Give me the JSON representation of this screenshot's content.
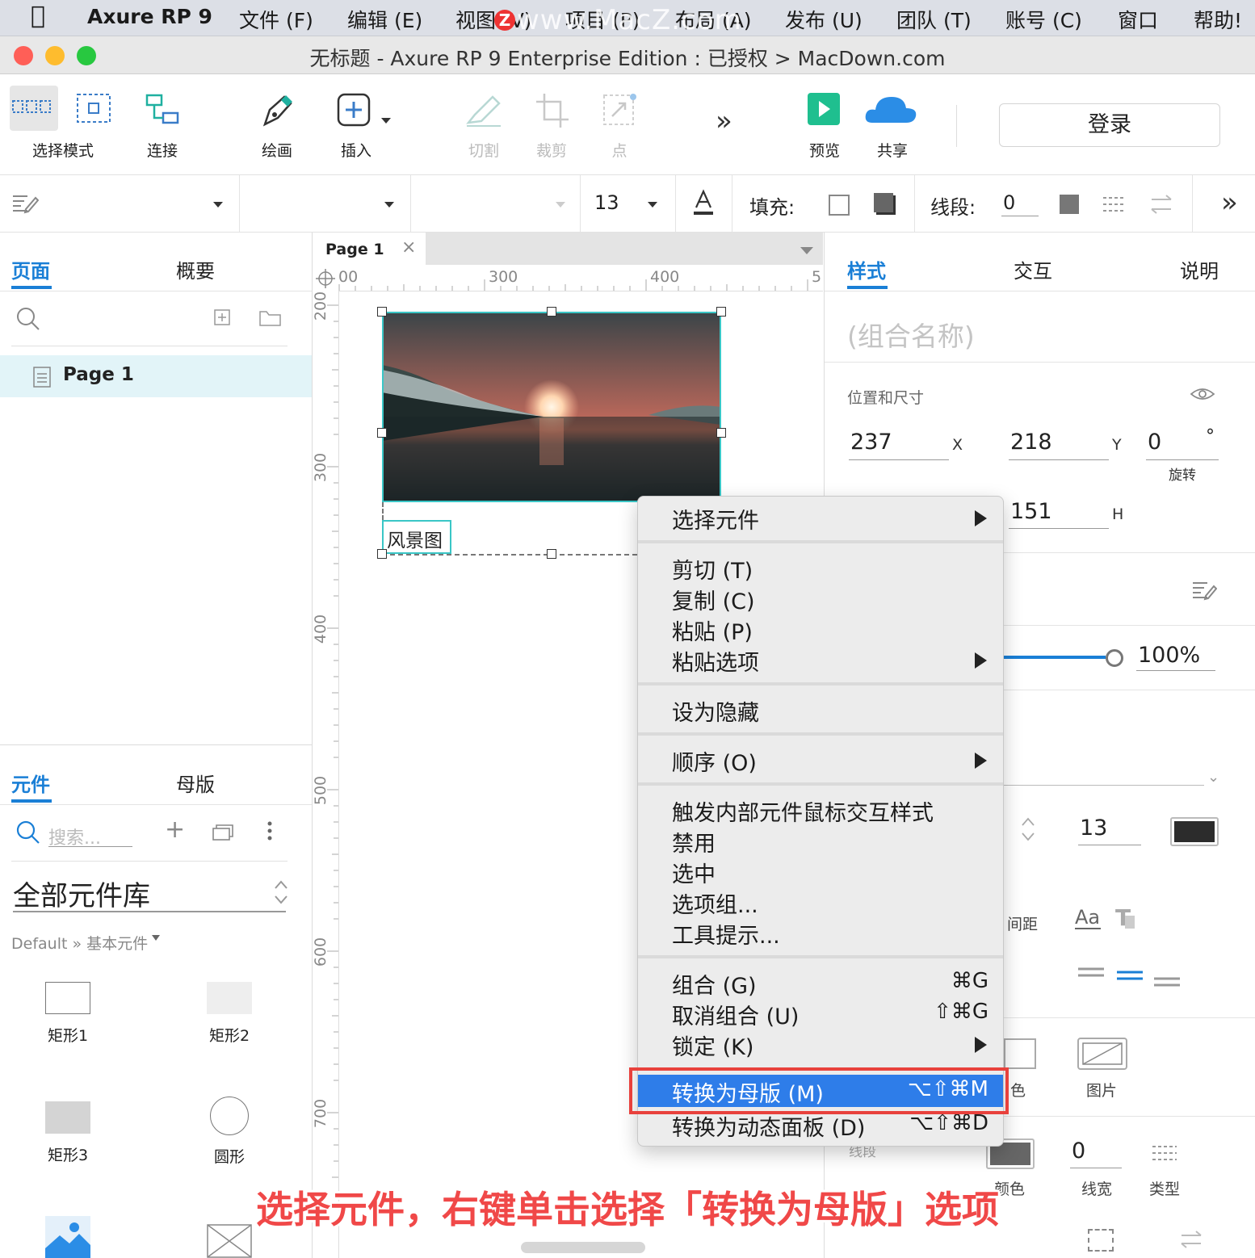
{
  "menubar": {
    "app": "Axure RP 9",
    "items": [
      "文件 (F)",
      "编辑 (E)",
      "视图 (V)",
      "项目 (P)",
      "布局 (A)",
      "发布 (U)",
      "团队 (T)",
      "账号 (C)",
      "窗口",
      "帮助!"
    ],
    "watermark": "www.MacZ.com",
    "watermark_badge": "Z"
  },
  "window": {
    "title": "无标题 - Axure RP 9 Enterprise Edition : 已授权 > MacDown.com",
    "traffic_lights": {
      "close": "#ff5f57",
      "minimize": "#febc2e",
      "zoom": "#28c840"
    }
  },
  "toolbar": {
    "select_mode": "选择模式",
    "connect": "连接",
    "draw": "绘画",
    "insert": "插入",
    "slice": "切割",
    "crop": "裁剪",
    "point": "点",
    "more": "»",
    "preview": "预览",
    "share": "共享",
    "login": "登录"
  },
  "formatbar": {
    "font_size": "13",
    "fill_label": "填充:",
    "stroke_label": "线段:",
    "stroke_value": "0",
    "more": "»"
  },
  "left_panel": {
    "tabs": [
      "页面",
      "概要"
    ],
    "pages": [
      "Page 1"
    ],
    "lib_tabs": [
      "元件",
      "母版"
    ],
    "search_placeholder": "搜索...",
    "library_name": "全部元件库",
    "breadcrumb": "Default » 基本元件",
    "widgets": [
      "矩形1",
      "矩形2",
      "矩形3",
      "圆形"
    ]
  },
  "canvas": {
    "tab_label": "Page 1",
    "ruler_h": [
      "00",
      "300",
      "400",
      "5"
    ],
    "ruler_v": [
      "200",
      "300",
      "400",
      "500",
      "600",
      "700"
    ],
    "image_label": "风景图"
  },
  "right_panel": {
    "tabs": [
      "样式",
      "交互",
      "说明"
    ],
    "group_name_placeholder": "(组合名称)",
    "section_position": "位置和尺寸",
    "x": "237",
    "x_label": "X",
    "y": "218",
    "y_label": "Y",
    "rotation": "0",
    "rotation_unit": "°",
    "rotation_label": "旋转",
    "h": "151",
    "h_label": "H",
    "opacity": "100%",
    "font_size": "13",
    "spacing_label": "间距",
    "fill_color_label": "色",
    "image_label": "图片",
    "stroke_section": "线段",
    "stroke_color_label": "颜色",
    "stroke_width": "0",
    "stroke_width_label": "线宽",
    "stroke_type_label": "类型"
  },
  "context_menu": {
    "select_widget": "选择元件",
    "cut": "剪切 (T)",
    "copy": "复制 (C)",
    "paste": "粘贴 (P)",
    "paste_options": "粘贴选项",
    "set_hidden": "设为隐藏",
    "order": "顺序 (O)",
    "trigger_styles": "触发内部元件鼠标交互样式",
    "disable": "禁用",
    "selected": "选中",
    "option_group": "选项组...",
    "tooltip": "工具提示...",
    "group": "组合 (G)",
    "group_sc": "⌘G",
    "ungroup": "取消组合 (U)",
    "ungroup_sc": "⇧⌘G",
    "lock": "锁定 (K)",
    "convert_master": "转换为母版 (M)",
    "convert_master_sc": "⌥⇧⌘M",
    "convert_panel": "转换为动态面板 (D)",
    "convert_panel_sc": "⌥⇧⌘D"
  },
  "caption": "选择元件，右键单击选择「转换为母版」选项",
  "colors": {
    "accent": "#1a7fd6",
    "highlight": "#2e7de9",
    "annotation": "#e8413c",
    "preview": "#1fbf8f",
    "share": "#2b8de6"
  }
}
